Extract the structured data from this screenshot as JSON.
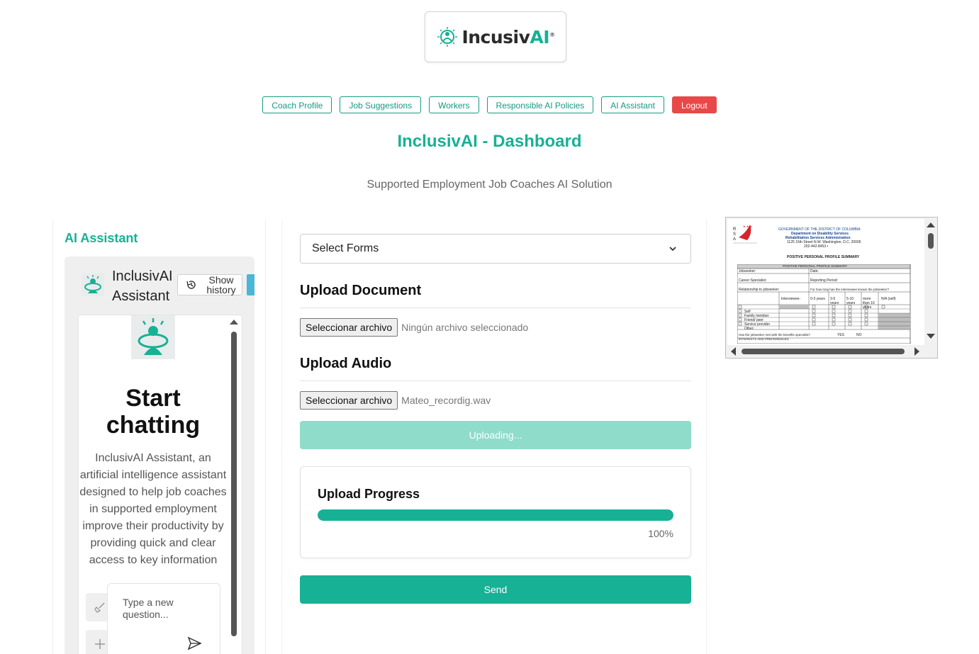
{
  "brand": {
    "name_left": "Incusiv",
    "name_right": "AI",
    "mark": "®"
  },
  "nav": [
    {
      "label": "Coach Profile"
    },
    {
      "label": "Job Suggestions"
    },
    {
      "label": "Workers"
    },
    {
      "label": "Responsible AI Policies"
    },
    {
      "label": "AI Assistant"
    },
    {
      "label": "Logout"
    }
  ],
  "page": {
    "title": "InclusivAI - Dashboard",
    "subtitle": "Supported Employment Job Coaches AI Solution"
  },
  "assistant": {
    "section_title": "AI Assistant",
    "header_title": "InclusivAI Assistant",
    "history_label": "Show history",
    "start_title": "Start chatting",
    "description": "InclusivAI Assistant, an artificial intelligence assistant designed to help job coaches in supported employment improve their productivity by providing quick and clear access to key information",
    "input_placeholder": "Type a new question..."
  },
  "form": {
    "select_value": "Select Forms",
    "upload_document": {
      "heading": "Upload Document",
      "button": "Seleccionar archivo",
      "file": "Ningún archivo seleccionado"
    },
    "upload_audio": {
      "heading": "Upload Audio",
      "button": "Seleccionar archivo",
      "file": "Mateo_recordig.wav"
    },
    "uploading_label": "Uploading...",
    "progress": {
      "title": "Upload Progress",
      "value": 100,
      "label": "100%"
    },
    "send_label": "Send"
  },
  "document_preview": {
    "org_lines": [
      "GOVERNMENT OF THE DISTRICT OF COLUMBIA",
      "Department on Disability Services",
      "Rehabilitation Services Administration",
      "1125 15th Street N.W. Washington, D.C. 20005",
      "202-442-8453 •"
    ],
    "doc_title": "POSITIVE PERSONAL PROFILE SUMMARY",
    "table_header": "POSITIVE PERSONAL PROFILE SUMMARY",
    "fields": [
      "Jobseeker:",
      "Date:",
      "Career Specialist:",
      "Reporting Period:",
      "Relationship to jobseeker:",
      "For how long has the interviewee known the jobseeker?"
    ],
    "columns": [
      "Interviewee:",
      "0-3 years",
      "3-5 years",
      "5-10 years",
      "more than 10 years",
      "N/A (self)"
    ],
    "rows": [
      "Self",
      "Family member",
      "Friend/ peer",
      "Service provider",
      "Other:"
    ],
    "question": "Has the jobseeker met with the benefits specialist?",
    "yes": "YES",
    "no": "NO",
    "footer_row": "INTERESTS AND PREFERENCES"
  },
  "colors": {
    "accent": "#17b195",
    "logout": "#e94848",
    "uploading": "#8fdcca"
  }
}
